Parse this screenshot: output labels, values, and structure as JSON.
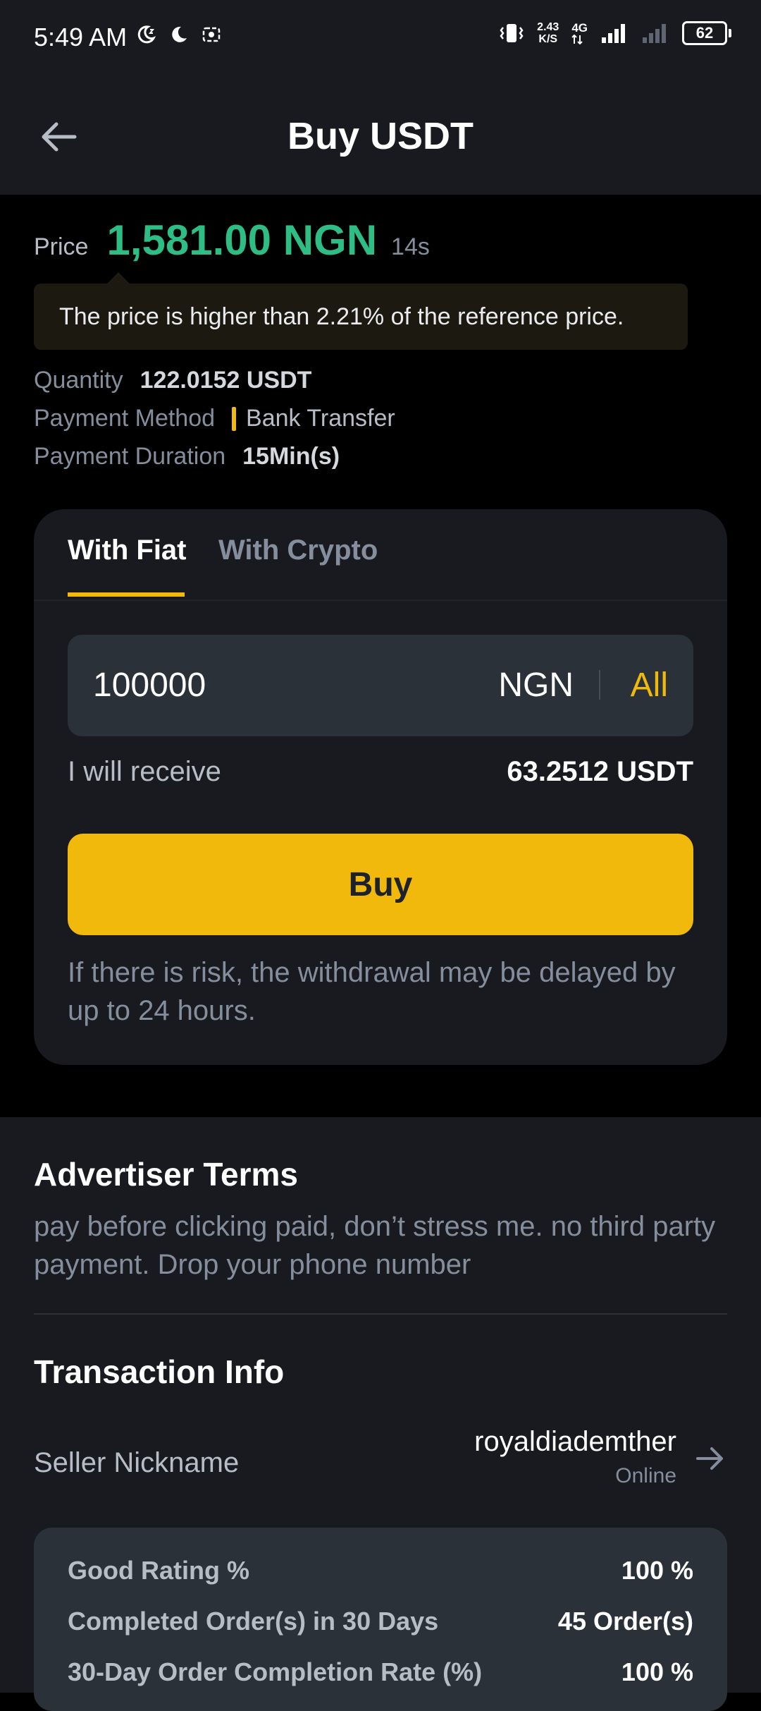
{
  "status_bar": {
    "time": "5:49 AM",
    "net_speed_value": "2.43",
    "net_speed_unit": "K/S",
    "network_type": "4G",
    "battery": "62"
  },
  "header": {
    "title": "Buy USDT"
  },
  "price": {
    "label": "Price",
    "value": "1,581.00 NGN",
    "timer": "14s",
    "tooltip": "The price is higher than 2.21% of the reference price."
  },
  "order_info": {
    "quantity_label": "Quantity",
    "quantity_value": "122.0152 USDT",
    "payment_method_label": "Payment Method",
    "payment_method_value": "Bank Transfer",
    "payment_duration_label": "Payment Duration",
    "payment_duration_value": "15Min(s)"
  },
  "card": {
    "tabs": [
      {
        "label": "With Fiat",
        "active": true
      },
      {
        "label": "With Crypto",
        "active": false
      }
    ],
    "amount": "100000",
    "currency": "NGN",
    "all_label": "All",
    "receive_label": "I will receive",
    "receive_value": "63.2512 USDT",
    "buy_label": "Buy",
    "risk_note": "If there is risk, the withdrawal may be delayed by up to 24 hours."
  },
  "advertiser_terms": {
    "title": "Advertiser Terms",
    "text": "pay before clicking paid, don’t stress me. no third party payment. Drop your phone number"
  },
  "transaction_info": {
    "title": "Transaction Info",
    "seller_label": "Seller Nickname",
    "seller_name": "royaldiademther",
    "seller_status": "Online",
    "stats": [
      {
        "label": "Good Rating %",
        "value": "100 %"
      },
      {
        "label": "Completed Order(s) in 30 Days",
        "value": "45 Order(s)"
      },
      {
        "label": "30-Day Order Completion Rate (%)",
        "value": "100 %"
      }
    ]
  },
  "colors": {
    "accent": "#F0B90B",
    "price_green": "#2EBD85",
    "background": "#000000",
    "surface": "#181A20"
  }
}
